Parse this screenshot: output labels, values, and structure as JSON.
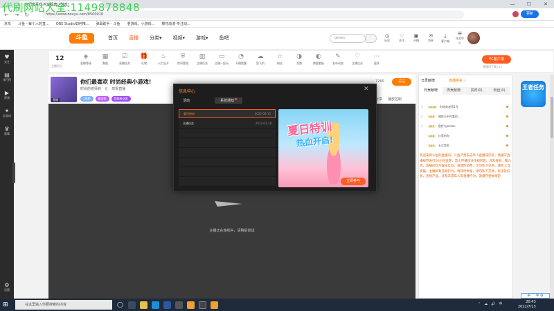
{
  "watermark": "代刷网站大全:1149878848",
  "browser": {
    "tab_title": "你们最喜欢 时尚经典小游戏!",
    "url": "https://www.douyu.com/8500016",
    "update_label": "更新",
    "window_controls": [
      "—",
      "☐",
      "✕"
    ],
    "bookmarks": [
      "京东",
      "斗鱼 - 每个人的直...",
      "OBS Studio如何推...",
      "弹幕助手 - 斗鱼",
      "老游戏、小游戏...",
      "樱花动漫-专注动..."
    ]
  },
  "site": {
    "logo": "斗鱼",
    "nav": [
      "首页",
      "直播",
      "分类▾",
      "视频▾",
      "游戏▾",
      "鱼吧"
    ],
    "search_placeholder": "genes",
    "header_icons": [
      {
        "icon": "history-icon",
        "label": "历史"
      },
      {
        "icon": "follow-icon",
        "label": "关注"
      },
      {
        "icon": "live-icon",
        "label": "开播"
      },
      {
        "icon": "message-icon",
        "label": "消息"
      },
      {
        "icon": "download-icon",
        "label": "客户端"
      },
      {
        "icon": "task-icon",
        "label": "任务中心"
      }
    ]
  },
  "left_sidebar": [
    {
      "icon": "heart-icon",
      "label": "关注"
    },
    {
      "icon": "chart-icon",
      "label": "排行榜"
    },
    {
      "icon": "video-icon",
      "label": "视频"
    },
    {
      "icon": "game-icon",
      "label": "云游戏"
    },
    {
      "icon": "trophy-icon",
      "label": "赛事"
    },
    {
      "icon": "gear-icon",
      "label": "设置"
    }
  ],
  "stats": {
    "level": "12",
    "level_label": "主播积分",
    "items": [
      {
        "icon": "level-icon",
        "label": "直播等级"
      },
      {
        "icon": "data-icon",
        "label": "数据"
      },
      {
        "icon": "task-icon",
        "label": "直播任务"
      },
      {
        "icon": "gift-icon",
        "label": "礼物"
      },
      {
        "icon": "fire-icon",
        "label": "火力全开"
      },
      {
        "icon": "shield-icon",
        "label": "房间管理"
      },
      {
        "icon": "board-icon",
        "label": "主播任务"
      },
      {
        "icon": "calendar-icon",
        "label": "主播一起玩"
      },
      {
        "icon": "clock-icon",
        "label": "开播提醒"
      },
      {
        "icon": "cloud-icon",
        "label": "鱼飞机"
      },
      {
        "icon": "star-icon",
        "label": "粉丝"
      },
      {
        "icon": "gauge-icon",
        "label": "竞猜"
      },
      {
        "icon": "meter-icon",
        "label": "数据看板"
      },
      {
        "icon": "edit-icon",
        "label": "发布动态"
      },
      {
        "icon": "heart-icon",
        "label": "主播后台"
      },
      {
        "icon": "more-icon",
        "label": "更多"
      }
    ],
    "pc_button": "PC客户端",
    "pc_sub": "直播间下载入口"
  },
  "room": {
    "thumb_label": "直播",
    "title": "你们最喜欢 时尚经典小游戏!",
    "meta": [
      "时尚的老师钩",
      "0",
      "举报直播"
    ],
    "tags": [
      "1周榜",
      "藏宝阁",
      "超级粉丝团"
    ],
    "follow_count": "7260",
    "follow_button": "关注",
    "actions": [
      "分享",
      "播放控制"
    ],
    "offline_text": "主播正在连线中，请稍后尝试"
  },
  "chat": {
    "rank_title": "日贡献榜",
    "rank_more": "直播排名 ›",
    "tabs": [
      "日贡献榜",
      "周贡献榜",
      "贵宾(0)",
      "粉丝(0)"
    ],
    "rows": [
      {
        "n": "1",
        "badge": "LV.10",
        "name": "时尚的老师1号"
      },
      {
        "n": "2",
        "badge": "LV.9",
        "name": "偶然与平时看的..."
      },
      {
        "n": "3",
        "badge": "LV.7",
        "name": "鱼籽与Jordan"
      },
      {
        "n": "",
        "badge": "LV.6",
        "name": "红莲的你"
      },
      {
        "n": "",
        "badge": "LV.5",
        "name": "五月是鱼"
      }
    ],
    "notice": "欢迎来到斗鱼的直播间，斗鱼严禁未成年人直播或打赏，请遵守直播规范进行24小时监管，禁止传播违法违规内容，涉及低俗、暴力等，直播间仅为娱乐互动，请理性消费，切勿私下交易，谨防上当受骗，主播如有违规行为，请及时举报，请勿私下交易，有涉及信息、违规产品、涉及未成年人等直播行为，请遵守相关规定"
  },
  "promo": {
    "text": "王者任务"
  },
  "modal": {
    "title": "信息中心",
    "tabs": [
      "活动",
      "系统通知"
    ],
    "items": [
      {
        "name": "夏日特训",
        "date": "2022-06-15"
      },
      {
        "name": "主播任务",
        "date": "2022-03-18"
      }
    ],
    "image_title_1": "夏日特训",
    "image_title_2": "热血开启!",
    "join_button": "立即参与"
  },
  "taskbar": {
    "search_placeholder": "在这里输入你要搜索的内容",
    "ime": "中 ⁀ 半 ⚙",
    "time": "20:43",
    "date": "2022/7/13",
    "tray": [
      "⌃",
      "☁",
      "🔊",
      "中"
    ]
  }
}
